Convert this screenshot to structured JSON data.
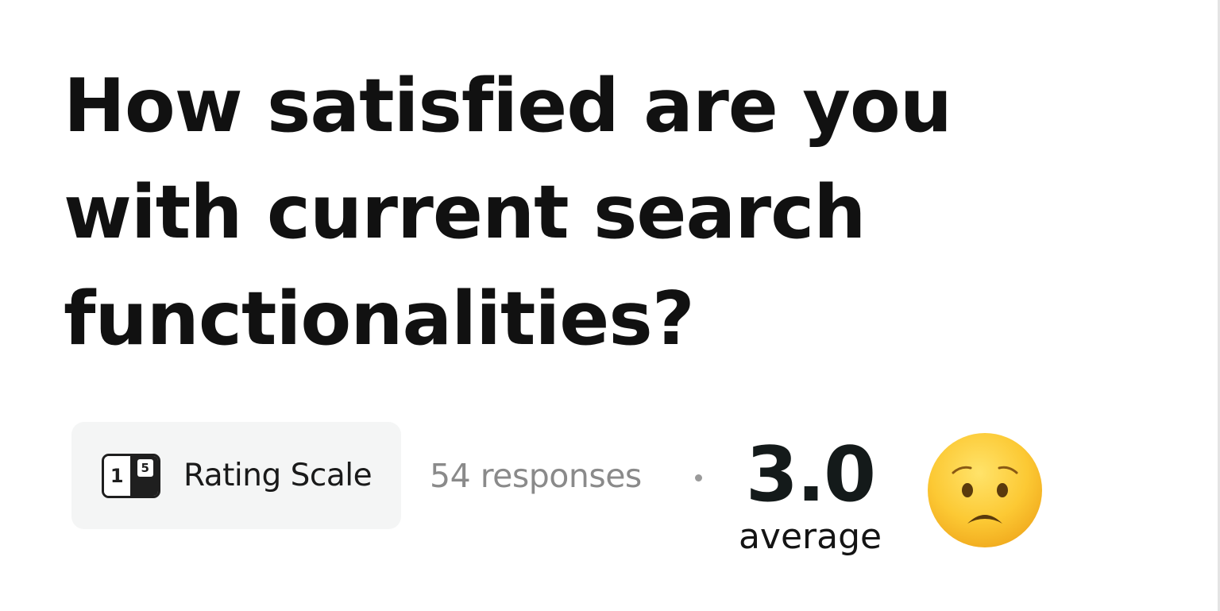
{
  "question": {
    "text": "How satisfied are you with current search functionalities?"
  },
  "question_type": {
    "icon": "rating-scale-icon",
    "icon_digits": [
      "1",
      "5"
    ],
    "label": "Rating Scale"
  },
  "stats": {
    "responses_text": "54 responses",
    "separator": "·",
    "average_value": "3.0",
    "average_label": "average",
    "sentiment_icon": "worried-face-emoji-icon"
  },
  "colors": {
    "text_primary": "#111111",
    "text_muted": "#8a8a8a",
    "chip_background": "#f4f5f5",
    "emoji_face": "#fbc02d"
  }
}
